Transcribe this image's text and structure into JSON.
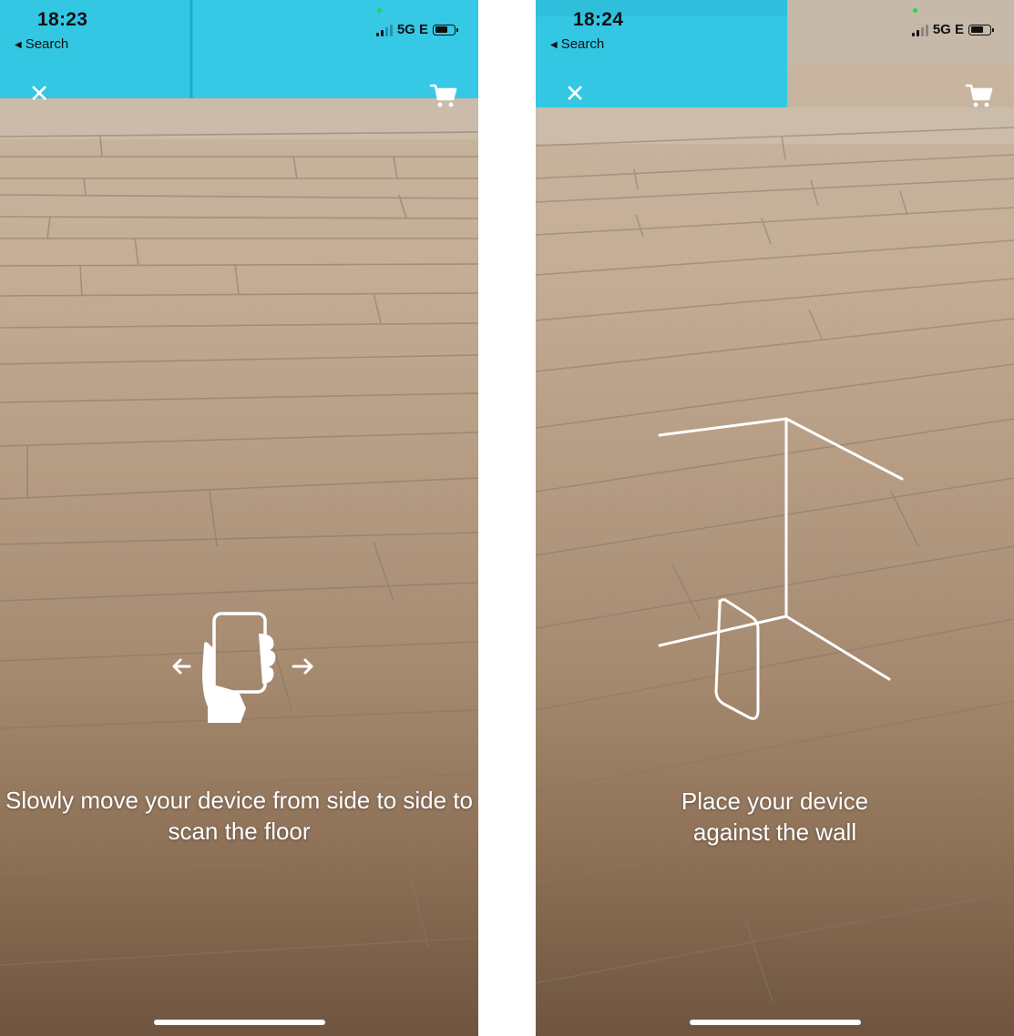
{
  "screens": [
    {
      "status_bar": {
        "time": "18:23",
        "back_label": "Search",
        "network": "5G E",
        "signal_bars": 4,
        "signal_active": 2,
        "battery_level": 0.6
      },
      "icons": {
        "close": "close-icon",
        "cart": "cart-icon",
        "illustration": "hand-holding-phone-icon",
        "left_arrow": "arrow-left-icon",
        "right_arrow": "arrow-right-icon"
      },
      "instruction": "Slowly move your device from side to side to scan the floor"
    },
    {
      "status_bar": {
        "time": "18:24",
        "back_label": "Search",
        "network": "5G E",
        "signal_bars": 4,
        "signal_active": 2,
        "battery_level": 0.6
      },
      "icons": {
        "close": "close-icon",
        "cart": "cart-icon",
        "illustration": "phone-against-wall-icon"
      },
      "instruction": "Place your device against the wall"
    }
  ],
  "colors": {
    "sofa": "#2fc6e4",
    "overlay_text": "#ffffff",
    "status_text": "#111111"
  }
}
